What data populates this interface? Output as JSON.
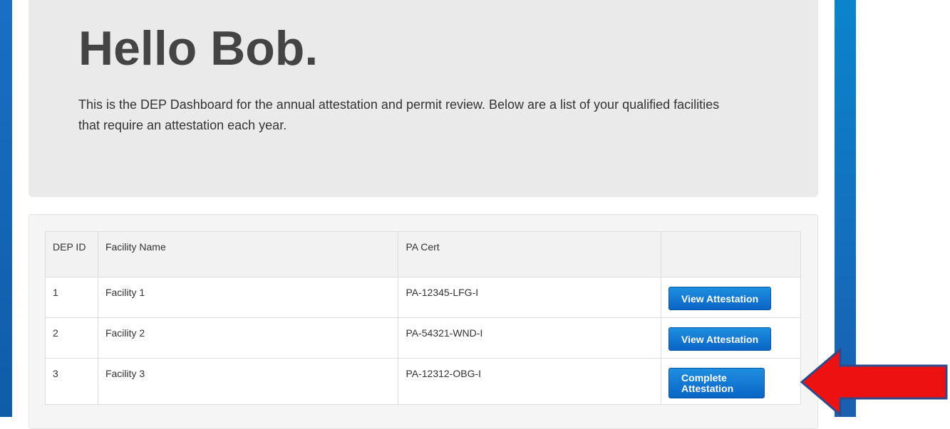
{
  "hero": {
    "greeting": "Hello Bob.",
    "description": "This is the DEP Dashboard for the annual attestation and permit review. Below are a list of your qualified facilities that require an attestation each year."
  },
  "table": {
    "headers": {
      "dep_id": "DEP ID",
      "facility_name": "Facility Name",
      "pa_cert": "PA Cert",
      "actions": ""
    },
    "rows": [
      {
        "dep_id": "1",
        "facility_name": "Facility 1",
        "pa_cert": "PA-12345-LFG-I",
        "action_label": "View Attestation"
      },
      {
        "dep_id": "2",
        "facility_name": "Facility 2",
        "pa_cert": "PA-54321-WND-I",
        "action_label": "View Attestation"
      },
      {
        "dep_id": "3",
        "facility_name": "Facility 3",
        "pa_cert": "PA-12312-OBG-I",
        "action_label": "Complete Attestation"
      }
    ]
  },
  "colors": {
    "accent_blue": "#0a64c6",
    "hero_background": "#eaeaea",
    "arrow_fill": "#ee1111",
    "arrow_stroke": "#2e4a8c"
  },
  "icons": {
    "annotation": "red-arrow-left-icon"
  }
}
